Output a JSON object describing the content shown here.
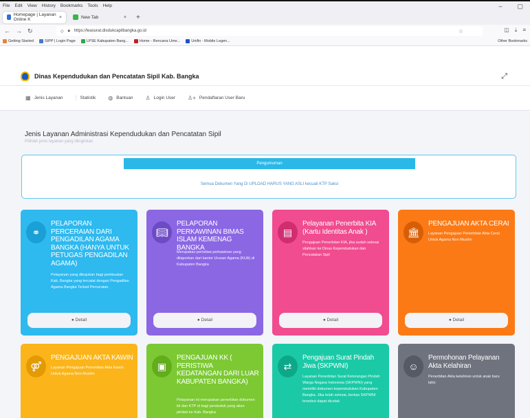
{
  "browser": {
    "menu": [
      "File",
      "Edit",
      "View",
      "History",
      "Bookmarks",
      "Tools",
      "Help"
    ],
    "window_controls": [
      "–",
      "▢"
    ],
    "tabs": [
      {
        "label": "Homepage | Layanan Online K",
        "close": "×"
      },
      {
        "label": "New Tab",
        "close": "×"
      }
    ],
    "new_tab": "+",
    "url": "https://leasurat.disdukcapilbangka.go.id",
    "bookmarks": [
      "Getting Started",
      "SIPP | Login Page",
      "LPSE Kabupaten Bang...",
      "Home - Rencana Ume...",
      "Unifin - Mobile Legen..."
    ],
    "other_bookmarks": "Other Bookmarks"
  },
  "site": {
    "title": "Dinas Kependudukan dan Pencatatan Sipil Kab. Bangka",
    "expand": "⤢",
    "nav": [
      {
        "label": "Jenis Layanan",
        "icon": "▦"
      },
      {
        "label": "Statistik",
        "icon": "⫶"
      },
      {
        "label": "Bantuan",
        "icon": "◍"
      },
      {
        "label": "Login User",
        "icon": "♙"
      },
      {
        "label": "Pendaftaran User Baru",
        "icon": "♙+"
      }
    ]
  },
  "main": {
    "title": "Jenis Layanan Administrasi Kependudukan dan Pencatatan Sipil",
    "subtitle": "Pilihlah jenis layanan yang diinginkan",
    "announcement_head": "Pengumuman",
    "announcement_text": "Semua Dokumen Yang Di UPLOAD HARUS YANG ASLI kecuali KTP Saksi"
  },
  "cards": [
    {
      "title": "PELAPORAN PERCERAIAN DARI PENGADILAN AGAMA BANGKA (HANYA UNTUK PETUGAS PENGADILAN AGAMA)",
      "desc": "Pelayanan yang dikujukan bagi pembuatan Kab. Bangka yang tercatat dengan Pengadilan Agama Bangka Terkait Perceraian.",
      "detail": "● Detail",
      "color": "#2eb9ef"
    },
    {
      "title": "PELAPORAN PERKAWINAN BIMAS ISLAM KEMENAG BANGKA",
      "desc": "Merupakan peristiwa perkawinan yang dilaporkan dari kantor Urusan Agama (KUA) di Kabupaten Bangka",
      "detail": "● Detail",
      "color": "#8b67e4"
    },
    {
      "title": "Pelayanan Penerbita KIA (Kartu Identitas Anak )",
      "desc": "Pengajuan Penerbitan KIA, jika sudah selesai silahkan ke Dinas Kependudukan dan Pencatatan Sipil",
      "detail": "● Detail",
      "color": "#f04c8f"
    },
    {
      "title": "PENGAJUAN AKTA CERAI",
      "desc": "Layanan Pengajuan Penerbitan Akta Cerai Untuk Agama Non Muslim",
      "detail": "● Detail",
      "color": "#fb7a15"
    },
    {
      "title": "PENGAJUAN AKTA KAWIN",
      "desc": "Layanan Pengajuan Penerbitan Akta Kawin Untuk Agama Non Muslim",
      "detail": "",
      "color": "#fbb51a"
    },
    {
      "title": "PENGAJUAN KK ( PERISTIWA KEDATANGAN DARI LUAR KABUPATEN BANGKA)",
      "desc": "Pelayanan ini merupakan penerbitan dokumen kk dan KTP el bagi penduduk yang akan pindah ke Kab. Bangka",
      "detail": "",
      "color": "#7cc934"
    },
    {
      "title": "Pengajuan Surat Pindah Jiwa (SKPWNI)",
      "desc": "Layanan Penerbitan Surat Keterangan Pindah Warga Negara Indonesia (SKPWNI) yang memiliki dokumen kependudukan Kabupaten Bangka. Jika telah selesai, berkas SKPWNI tersebut dapat dicetak",
      "detail": "",
      "color": "#1bc9a6"
    },
    {
      "title": "Permohonan Pelayanan Akta Kelahiran",
      "desc": "Penerbitan Akta kelahiran untuk anak baru lahir.",
      "detail": "",
      "color": "#6e737e"
    }
  ]
}
